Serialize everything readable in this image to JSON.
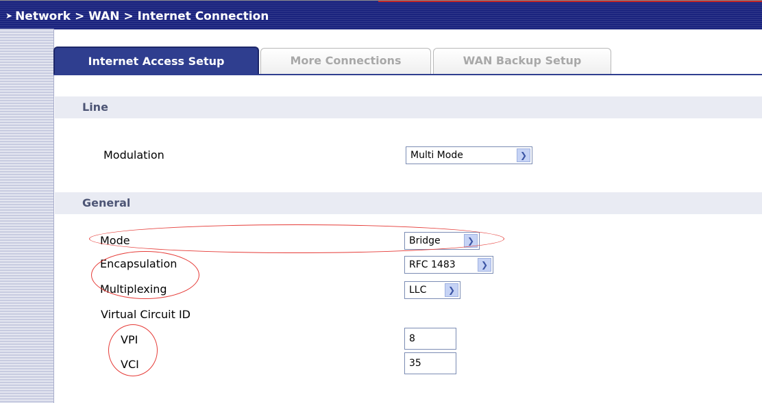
{
  "breadcrumb": "Network > WAN > Internet Connection",
  "tabs": [
    {
      "label": "Internet Access Setup",
      "active": true
    },
    {
      "label": "More Connections",
      "active": false
    },
    {
      "label": "WAN Backup Setup",
      "active": false
    }
  ],
  "sections": {
    "line": {
      "title": "Line",
      "modulation": {
        "label": "Modulation",
        "value": "Multi Mode"
      }
    },
    "general": {
      "title": "General",
      "mode": {
        "label": "Mode",
        "value": "Bridge"
      },
      "encapsulation": {
        "label": "Encapsulation",
        "value": "RFC 1483"
      },
      "multiplexing": {
        "label": "Multiplexing",
        "value": "LLC"
      },
      "vcid": {
        "label": "Virtual Circuit ID"
      },
      "vpi": {
        "label": "VPI",
        "value": "8"
      },
      "vci": {
        "label": "VCI",
        "value": "35"
      }
    }
  },
  "colors": {
    "header": "#1a237e",
    "active_tab": "#2f3e8f",
    "annotation": "#e53935"
  },
  "icons": {
    "breadcrumb_arrow": "arrow-icon",
    "dropdown": "chevron-down-icon"
  }
}
